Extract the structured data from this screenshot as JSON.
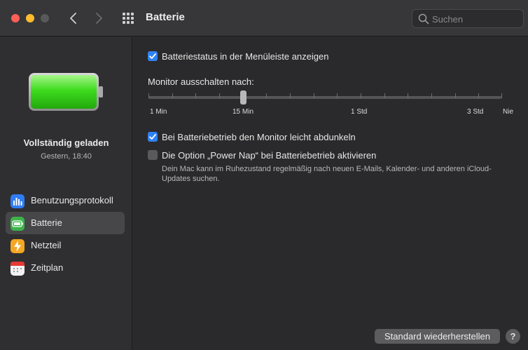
{
  "window": {
    "title": "Batterie",
    "search": {
      "placeholder": "Suchen",
      "value": ""
    }
  },
  "sidebar": {
    "battery_status": "Vollständig geladen",
    "battery_time": "Gestern, 18:40",
    "battery_level_percent": 100,
    "items": [
      {
        "label": "Benutzungsprotokoll",
        "icon": "chart-bars-icon",
        "color": "#2f7df5",
        "active": false
      },
      {
        "label": "Batterie",
        "icon": "battery-icon",
        "color": "#3cb34a",
        "active": true
      },
      {
        "label": "Netzteil",
        "icon": "bolt-icon",
        "color": "#f5a623",
        "active": false
      },
      {
        "label": "Zeitplan",
        "icon": "calendar-icon",
        "color": "#f2f2f2",
        "active": false
      }
    ]
  },
  "main": {
    "menubar_checkbox": {
      "label": "Batteriestatus in der Menüleiste anzeigen",
      "checked": true
    },
    "slider": {
      "label": "Monitor ausschalten nach:",
      "value": "15 Min",
      "ticks": [
        "1 Min",
        "15 Min",
        "1 Std",
        "3 Std",
        "Nie"
      ]
    },
    "dim_checkbox": {
      "label": "Bei Batteriebetrieb den Monitor leicht abdunkeln",
      "checked": true
    },
    "powernap_checkbox": {
      "label": "Die Option „Power Nap“ bei Batteriebetrieb aktivieren",
      "checked": false,
      "description_line1": "Dein Mac kann im Ruhezustand regelmäßig nach neuen E-Mails, Kalender- und anderen iCloud-",
      "description_line2": "Updates suchen."
    },
    "restore_button": "Standard wiederherstellen",
    "help_button": "?"
  },
  "colors": {
    "accent": "#2f82f4",
    "battery_fill": "#3ddc1e"
  }
}
